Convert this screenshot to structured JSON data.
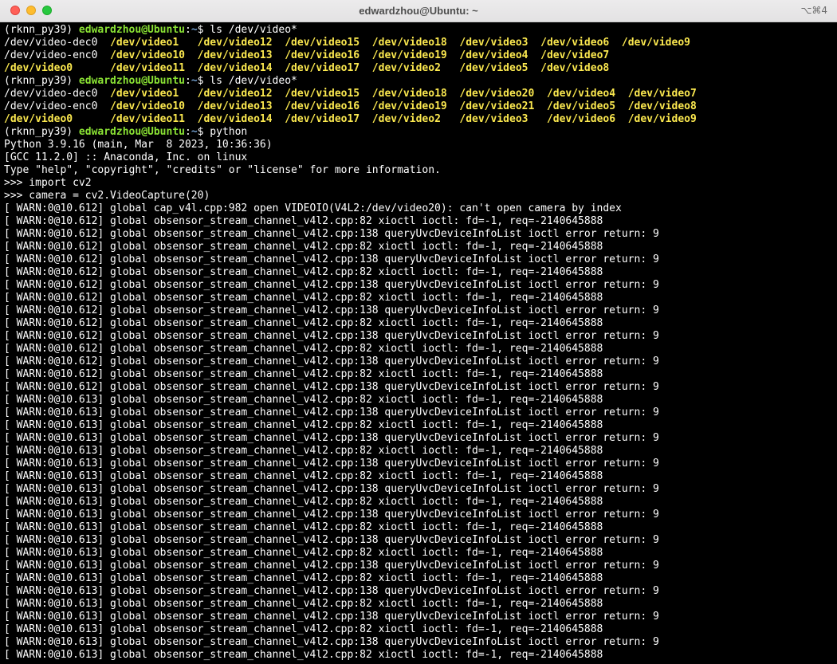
{
  "window": {
    "title": "edwardzhou@Ubuntu: ~",
    "shortcut": "⌥⌘4"
  },
  "colors": {
    "prompt_user": "#8ae234",
    "prompt_path": "#729fcf",
    "device_file": "#fce94f",
    "background": "#000000",
    "text": "#ffffff"
  },
  "terminal": {
    "lines": [
      [
        {
          "t": "(rknn_py39) "
        },
        {
          "t": "edwardzhou@Ubuntu",
          "c": "green-bold"
        },
        {
          "t": ":"
        },
        {
          "t": "~",
          "c": "blue-bold"
        },
        {
          "t": "$ ls /dev/video*"
        }
      ],
      [
        {
          "t": "/dev/video-dec0  "
        },
        {
          "t": "/dev/video1",
          "c": "yellow-bold"
        },
        {
          "t": "   "
        },
        {
          "t": "/dev/video12",
          "c": "yellow-bold"
        },
        {
          "t": "  "
        },
        {
          "t": "/dev/video15",
          "c": "yellow-bold"
        },
        {
          "t": "  "
        },
        {
          "t": "/dev/video18",
          "c": "yellow-bold"
        },
        {
          "t": "  "
        },
        {
          "t": "/dev/video3",
          "c": "yellow-bold"
        },
        {
          "t": "  "
        },
        {
          "t": "/dev/video6",
          "c": "yellow-bold"
        },
        {
          "t": "  "
        },
        {
          "t": "/dev/video9",
          "c": "yellow-bold"
        }
      ],
      [
        {
          "t": "/dev/video-enc0  "
        },
        {
          "t": "/dev/video10",
          "c": "yellow-bold"
        },
        {
          "t": "  "
        },
        {
          "t": "/dev/video13",
          "c": "yellow-bold"
        },
        {
          "t": "  "
        },
        {
          "t": "/dev/video16",
          "c": "yellow-bold"
        },
        {
          "t": "  "
        },
        {
          "t": "/dev/video19",
          "c": "yellow-bold"
        },
        {
          "t": "  "
        },
        {
          "t": "/dev/video4",
          "c": "yellow-bold"
        },
        {
          "t": "  "
        },
        {
          "t": "/dev/video7",
          "c": "yellow-bold"
        }
      ],
      [
        {
          "t": "/dev/video0",
          "c": "yellow-bold"
        },
        {
          "t": "      "
        },
        {
          "t": "/dev/video11",
          "c": "yellow-bold"
        },
        {
          "t": "  "
        },
        {
          "t": "/dev/video14",
          "c": "yellow-bold"
        },
        {
          "t": "  "
        },
        {
          "t": "/dev/video17",
          "c": "yellow-bold"
        },
        {
          "t": "  "
        },
        {
          "t": "/dev/video2",
          "c": "yellow-bold"
        },
        {
          "t": "   "
        },
        {
          "t": "/dev/video5",
          "c": "yellow-bold"
        },
        {
          "t": "  "
        },
        {
          "t": "/dev/video8",
          "c": "yellow-bold"
        }
      ],
      [
        {
          "t": "(rknn_py39) "
        },
        {
          "t": "edwardzhou@Ubuntu",
          "c": "green-bold"
        },
        {
          "t": ":"
        },
        {
          "t": "~",
          "c": "blue-bold"
        },
        {
          "t": "$ ls /dev/video*"
        }
      ],
      [
        {
          "t": "/dev/video-dec0  "
        },
        {
          "t": "/dev/video1",
          "c": "yellow-bold"
        },
        {
          "t": "   "
        },
        {
          "t": "/dev/video12",
          "c": "yellow-bold"
        },
        {
          "t": "  "
        },
        {
          "t": "/dev/video15",
          "c": "yellow-bold"
        },
        {
          "t": "  "
        },
        {
          "t": "/dev/video18",
          "c": "yellow-bold"
        },
        {
          "t": "  "
        },
        {
          "t": "/dev/video20",
          "c": "yellow-bold"
        },
        {
          "t": "  "
        },
        {
          "t": "/dev/video4",
          "c": "yellow-bold"
        },
        {
          "t": "  "
        },
        {
          "t": "/dev/video7",
          "c": "yellow-bold"
        }
      ],
      [
        {
          "t": "/dev/video-enc0  "
        },
        {
          "t": "/dev/video10",
          "c": "yellow-bold"
        },
        {
          "t": "  "
        },
        {
          "t": "/dev/video13",
          "c": "yellow-bold"
        },
        {
          "t": "  "
        },
        {
          "t": "/dev/video16",
          "c": "yellow-bold"
        },
        {
          "t": "  "
        },
        {
          "t": "/dev/video19",
          "c": "yellow-bold"
        },
        {
          "t": "  "
        },
        {
          "t": "/dev/video21",
          "c": "yellow-bold"
        },
        {
          "t": "  "
        },
        {
          "t": "/dev/video5",
          "c": "yellow-bold"
        },
        {
          "t": "  "
        },
        {
          "t": "/dev/video8",
          "c": "yellow-bold"
        }
      ],
      [
        {
          "t": "/dev/video0",
          "c": "yellow-bold"
        },
        {
          "t": "      "
        },
        {
          "t": "/dev/video11",
          "c": "yellow-bold"
        },
        {
          "t": "  "
        },
        {
          "t": "/dev/video14",
          "c": "yellow-bold"
        },
        {
          "t": "  "
        },
        {
          "t": "/dev/video17",
          "c": "yellow-bold"
        },
        {
          "t": "  "
        },
        {
          "t": "/dev/video2",
          "c": "yellow-bold"
        },
        {
          "t": "   "
        },
        {
          "t": "/dev/video3",
          "c": "yellow-bold"
        },
        {
          "t": "   "
        },
        {
          "t": "/dev/video6",
          "c": "yellow-bold"
        },
        {
          "t": "  "
        },
        {
          "t": "/dev/video9",
          "c": "yellow-bold"
        }
      ],
      [
        {
          "t": "(rknn_py39) "
        },
        {
          "t": "edwardzhou@Ubuntu",
          "c": "green-bold"
        },
        {
          "t": ":"
        },
        {
          "t": "~",
          "c": "blue-bold"
        },
        {
          "t": "$ python"
        }
      ],
      [
        {
          "t": "Python 3.9.16 (main, Mar  8 2023, 10:36:36)"
        }
      ],
      [
        {
          "t": "[GCC 11.2.0] :: Anaconda, Inc. on linux"
        }
      ],
      [
        {
          "t": "Type \"help\", \"copyright\", \"credits\" or \"license\" for more information."
        }
      ],
      [
        {
          "t": ">>> import cv2"
        }
      ],
      [
        {
          "t": ">>> camera = cv2.VideoCapture(20)"
        }
      ],
      [
        {
          "t": "[ WARN:0@10.612] global cap_v4l.cpp:982 open VIDEOIO(V4L2:/dev/video20): can't open camera by index"
        }
      ],
      [
        {
          "t": "[ WARN:0@10.612] global obsensor_stream_channel_v4l2.cpp:82 xioctl ioctl: fd=-1, req=-2140645888"
        }
      ],
      [
        {
          "t": "[ WARN:0@10.612] global obsensor_stream_channel_v4l2.cpp:138 queryUvcDeviceInfoList ioctl error return: 9"
        }
      ],
      [
        {
          "t": "[ WARN:0@10.612] global obsensor_stream_channel_v4l2.cpp:82 xioctl ioctl: fd=-1, req=-2140645888"
        }
      ],
      [
        {
          "t": "[ WARN:0@10.612] global obsensor_stream_channel_v4l2.cpp:138 queryUvcDeviceInfoList ioctl error return: 9"
        }
      ],
      [
        {
          "t": "[ WARN:0@10.612] global obsensor_stream_channel_v4l2.cpp:82 xioctl ioctl: fd=-1, req=-2140645888"
        }
      ],
      [
        {
          "t": "[ WARN:0@10.612] global obsensor_stream_channel_v4l2.cpp:138 queryUvcDeviceInfoList ioctl error return: 9"
        }
      ],
      [
        {
          "t": "[ WARN:0@10.612] global obsensor_stream_channel_v4l2.cpp:82 xioctl ioctl: fd=-1, req=-2140645888"
        }
      ],
      [
        {
          "t": "[ WARN:0@10.612] global obsensor_stream_channel_v4l2.cpp:138 queryUvcDeviceInfoList ioctl error return: 9"
        }
      ],
      [
        {
          "t": "[ WARN:0@10.612] global obsensor_stream_channel_v4l2.cpp:82 xioctl ioctl: fd=-1, req=-2140645888"
        }
      ],
      [
        {
          "t": "[ WARN:0@10.612] global obsensor_stream_channel_v4l2.cpp:138 queryUvcDeviceInfoList ioctl error return: 9"
        }
      ],
      [
        {
          "t": "[ WARN:0@10.612] global obsensor_stream_channel_v4l2.cpp:82 xioctl ioctl: fd=-1, req=-2140645888"
        }
      ],
      [
        {
          "t": "[ WARN:0@10.612] global obsensor_stream_channel_v4l2.cpp:138 queryUvcDeviceInfoList ioctl error return: 9"
        }
      ],
      [
        {
          "t": "[ WARN:0@10.612] global obsensor_stream_channel_v4l2.cpp:82 xioctl ioctl: fd=-1, req=-2140645888"
        }
      ],
      [
        {
          "t": "[ WARN:0@10.612] global obsensor_stream_channel_v4l2.cpp:138 queryUvcDeviceInfoList ioctl error return: 9"
        }
      ],
      [
        {
          "t": "[ WARN:0@10.613] global obsensor_stream_channel_v4l2.cpp:82 xioctl ioctl: fd=-1, req=-2140645888"
        }
      ],
      [
        {
          "t": "[ WARN:0@10.613] global obsensor_stream_channel_v4l2.cpp:138 queryUvcDeviceInfoList ioctl error return: 9"
        }
      ],
      [
        {
          "t": "[ WARN:0@10.613] global obsensor_stream_channel_v4l2.cpp:82 xioctl ioctl: fd=-1, req=-2140645888"
        }
      ],
      [
        {
          "t": "[ WARN:0@10.613] global obsensor_stream_channel_v4l2.cpp:138 queryUvcDeviceInfoList ioctl error return: 9"
        }
      ],
      [
        {
          "t": "[ WARN:0@10.613] global obsensor_stream_channel_v4l2.cpp:82 xioctl ioctl: fd=-1, req=-2140645888"
        }
      ],
      [
        {
          "t": "[ WARN:0@10.613] global obsensor_stream_channel_v4l2.cpp:138 queryUvcDeviceInfoList ioctl error return: 9"
        }
      ],
      [
        {
          "t": "[ WARN:0@10.613] global obsensor_stream_channel_v4l2.cpp:82 xioctl ioctl: fd=-1, req=-2140645888"
        }
      ],
      [
        {
          "t": "[ WARN:0@10.613] global obsensor_stream_channel_v4l2.cpp:138 queryUvcDeviceInfoList ioctl error return: 9"
        }
      ],
      [
        {
          "t": "[ WARN:0@10.613] global obsensor_stream_channel_v4l2.cpp:82 xioctl ioctl: fd=-1, req=-2140645888"
        }
      ],
      [
        {
          "t": "[ WARN:0@10.613] global obsensor_stream_channel_v4l2.cpp:138 queryUvcDeviceInfoList ioctl error return: 9"
        }
      ],
      [
        {
          "t": "[ WARN:0@10.613] global obsensor_stream_channel_v4l2.cpp:82 xioctl ioctl: fd=-1, req=-2140645888"
        }
      ],
      [
        {
          "t": "[ WARN:0@10.613] global obsensor_stream_channel_v4l2.cpp:138 queryUvcDeviceInfoList ioctl error return: 9"
        }
      ],
      [
        {
          "t": "[ WARN:0@10.613] global obsensor_stream_channel_v4l2.cpp:82 xioctl ioctl: fd=-1, req=-2140645888"
        }
      ],
      [
        {
          "t": "[ WARN:0@10.613] global obsensor_stream_channel_v4l2.cpp:138 queryUvcDeviceInfoList ioctl error return: 9"
        }
      ],
      [
        {
          "t": "[ WARN:0@10.613] global obsensor_stream_channel_v4l2.cpp:82 xioctl ioctl: fd=-1, req=-2140645888"
        }
      ],
      [
        {
          "t": "[ WARN:0@10.613] global obsensor_stream_channel_v4l2.cpp:138 queryUvcDeviceInfoList ioctl error return: 9"
        }
      ],
      [
        {
          "t": "[ WARN:0@10.613] global obsensor_stream_channel_v4l2.cpp:82 xioctl ioctl: fd=-1, req=-2140645888"
        }
      ],
      [
        {
          "t": "[ WARN:0@10.613] global obsensor_stream_channel_v4l2.cpp:138 queryUvcDeviceInfoList ioctl error return: 9"
        }
      ],
      [
        {
          "t": "[ WARN:0@10.613] global obsensor_stream_channel_v4l2.cpp:82 xioctl ioctl: fd=-1, req=-2140645888"
        }
      ],
      [
        {
          "t": "[ WARN:0@10.613] global obsensor_stream_channel_v4l2.cpp:138 queryUvcDeviceInfoList ioctl error return: 9"
        }
      ],
      [
        {
          "t": "[ WARN:0@10.613] global obsensor_stream_channel_v4l2.cpp:82 xioctl ioctl: fd=-1, req=-2140645888"
        }
      ]
    ]
  }
}
